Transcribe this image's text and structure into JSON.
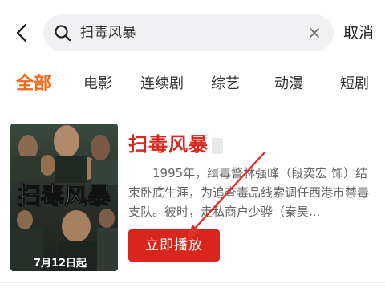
{
  "header": {
    "search_query": "扫毒风暴",
    "cancel_label": "取消",
    "icons": {
      "back": "chevron-left-icon",
      "search": "search-icon",
      "clear": "close-icon"
    }
  },
  "tabs": [
    {
      "label": "全部",
      "active": true
    },
    {
      "label": "电影",
      "active": false
    },
    {
      "label": "连续剧",
      "active": false
    },
    {
      "label": "综艺",
      "active": false
    },
    {
      "label": "动漫",
      "active": false
    },
    {
      "label": "短剧",
      "active": false
    }
  ],
  "result": {
    "title": "扫毒风暴",
    "description": "1995年，缉毒警林强峰（段奕宏 饰）结束卧底生涯，为追查毒品线索调任西港市禁毒支队。彼时，走私商户少骅（秦昊...",
    "play_label": "立即播放",
    "poster": {
      "title_text": "扫毒风暴",
      "date_text": "7月12日起"
    }
  },
  "colors": {
    "accent_orange": "#f26b1d",
    "brand_red": "#d9261c",
    "search_bg": "#f1f1f3",
    "annotation_red": "#e0302a"
  }
}
